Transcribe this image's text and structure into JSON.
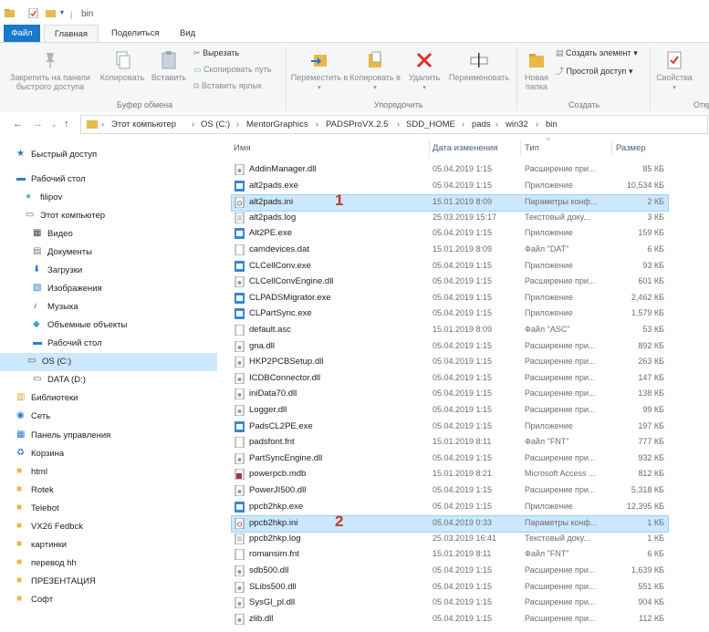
{
  "window": {
    "title": "bin"
  },
  "tabs": [
    {
      "label": "Файл"
    },
    {
      "label": "Главная"
    },
    {
      "label": "Поделиться"
    },
    {
      "label": "Вид"
    }
  ],
  "ribbon": {
    "pin_label": "Закрепить на панели быстрого доступа",
    "copy_label": "Копировать",
    "paste_label": "Вставить",
    "cut_label": "Вырезать",
    "copy_path_label": "Скопировать путь",
    "paste_shortcut_label": "Вставить ярлык",
    "clipboard_group": "Буфер обмена",
    "move_to_label": "Переместить в",
    "copy_to_label": "Копировать в",
    "delete_label": "Удалить",
    "rename_label": "Переименовать",
    "organize_group": "Упорядочить",
    "new_folder_label": "Новая папка",
    "new_item_label": "Создать элемент",
    "easy_access_label": "Простой доступ",
    "create_group": "Создать",
    "properties_label": "Свойства",
    "open_group": "Откр"
  },
  "address": {
    "crumbs": [
      "Этот компьютер",
      "OS (C:)",
      "MentorGraphics",
      "PADSProVX.2.5",
      "SDD_HOME",
      "pads",
      "win32",
      "bin"
    ]
  },
  "nav": {
    "items": [
      {
        "label": "Быстрый доступ",
        "icon": "star-icon"
      },
      {
        "label": "Рабочий стол",
        "icon": "desktop-icon"
      },
      {
        "label": "filipov",
        "icon": "user-icon"
      },
      {
        "label": "Этот компьютер",
        "icon": "computer-icon"
      },
      {
        "label": "Видео",
        "icon": "video-icon"
      },
      {
        "label": "Документы",
        "icon": "documents-icon"
      },
      {
        "label": "Загрузки",
        "icon": "download-icon"
      },
      {
        "label": "Изображения",
        "icon": "pictures-icon"
      },
      {
        "label": "Музыка",
        "icon": "music-icon"
      },
      {
        "label": "Объемные объекты",
        "icon": "3d-objects-icon"
      },
      {
        "label": "Рабочий стол",
        "icon": "desktop-icon"
      },
      {
        "label": "OS (C:)",
        "icon": "drive-icon"
      },
      {
        "label": "DATA (D:)",
        "icon": "drive-icon"
      },
      {
        "label": "Библиотеки",
        "icon": "libraries-icon"
      },
      {
        "label": "Сеть",
        "icon": "network-icon"
      },
      {
        "label": "Панель управления",
        "icon": "control-panel-icon"
      },
      {
        "label": "Корзина",
        "icon": "recycle-bin-icon"
      },
      {
        "label": "html",
        "icon": "folder-icon"
      },
      {
        "label": "Rotek",
        "icon": "folder-icon"
      },
      {
        "label": "Telebot",
        "icon": "folder-icon"
      },
      {
        "label": "VX26 Fedbck",
        "icon": "folder-icon"
      },
      {
        "label": "картинки",
        "icon": "folder-icon"
      },
      {
        "label": "перевод hh",
        "icon": "folder-icon"
      },
      {
        "label": "ПРЕЗЕНТАЦИЯ",
        "icon": "folder-icon"
      },
      {
        "label": "Софт",
        "icon": "folder-icon"
      }
    ],
    "selected_index": 11
  },
  "columns": {
    "name": "Имя",
    "date": "Дата изменения",
    "type": "Тип",
    "size": "Размер"
  },
  "files": [
    {
      "name": "AddinManager.dll",
      "date": "05.04.2019 1:15",
      "type": "Расширение при...",
      "size": "85 КБ",
      "icon": "dll"
    },
    {
      "name": "alt2pads.exe",
      "date": "05.04.2019 1:15",
      "type": "Приложение",
      "size": "10,534 КБ",
      "icon": "exe"
    },
    {
      "name": "alt2pads.ini",
      "date": "15.01.2019 8:09",
      "type": "Параметры конф...",
      "size": "2 КБ",
      "icon": "ini"
    },
    {
      "name": "alt2pads.log",
      "date": "25.03.2019 15:17",
      "type": "Текстовый доку...",
      "size": "3 КБ",
      "icon": "txt"
    },
    {
      "name": "Alt2PE.exe",
      "date": "05.04.2019 1:15",
      "type": "Приложение",
      "size": "159 КБ",
      "icon": "exe"
    },
    {
      "name": "camdevices.dat",
      "date": "15.01.2019 8:09",
      "type": "Файл \"DAT\"",
      "size": "6 КБ",
      "icon": "blank"
    },
    {
      "name": "CLCellConv.exe",
      "date": "05.04.2019 1:15",
      "type": "Приложение",
      "size": "93 КБ",
      "icon": "exe"
    },
    {
      "name": "CLCellConvEngine.dll",
      "date": "05.04.2019 1:15",
      "type": "Расширение при...",
      "size": "601 КБ",
      "icon": "dll"
    },
    {
      "name": "CLPADSMigrator.exe",
      "date": "05.04.2019 1:15",
      "type": "Приложение",
      "size": "2,462 КБ",
      "icon": "exe"
    },
    {
      "name": "CLPartSync.exe",
      "date": "05.04.2019 1:15",
      "type": "Приложение",
      "size": "1,579 КБ",
      "icon": "exe"
    },
    {
      "name": "default.asc",
      "date": "15.01.2019 8:09",
      "type": "Файл \"ASC\"",
      "size": "53 КБ",
      "icon": "blank"
    },
    {
      "name": "gna.dll",
      "date": "05.04.2019 1:15",
      "type": "Расширение при...",
      "size": "892 КБ",
      "icon": "dll"
    },
    {
      "name": "HKP2PCBSetup.dll",
      "date": "05.04.2019 1:15",
      "type": "Расширение при...",
      "size": "263 КБ",
      "icon": "dll"
    },
    {
      "name": "ICDBConnector.dll",
      "date": "05.04.2019 1:15",
      "type": "Расширение при...",
      "size": "147 КБ",
      "icon": "dll"
    },
    {
      "name": "iniData70.dll",
      "date": "05.04.2019 1:15",
      "type": "Расширение при...",
      "size": "138 КБ",
      "icon": "dll"
    },
    {
      "name": "Logger.dll",
      "date": "05.04.2019 1:15",
      "type": "Расширение при...",
      "size": "99 КБ",
      "icon": "dll"
    },
    {
      "name": "PadsCL2PE.exe",
      "date": "05.04.2019 1:15",
      "type": "Приложение",
      "size": "197 КБ",
      "icon": "exe"
    },
    {
      "name": "padsfont.fnt",
      "date": "15.01.2019 8:11",
      "type": "Файл \"FNT\"",
      "size": "777 КБ",
      "icon": "blank"
    },
    {
      "name": "PartSyncEngine.dll",
      "date": "05.04.2019 1:15",
      "type": "Расширение при...",
      "size": "932 КБ",
      "icon": "dll"
    },
    {
      "name": "powerpcb.mdb",
      "date": "15.01.2019 8:21",
      "type": "Microsoft Access ...",
      "size": "812 КБ",
      "icon": "mdb"
    },
    {
      "name": "PowerJI500.dll",
      "date": "05.04.2019 1:15",
      "type": "Расширение при...",
      "size": "5,318 КБ",
      "icon": "dll"
    },
    {
      "name": "ppcb2hkp.exe",
      "date": "05.04.2019 1:15",
      "type": "Приложение",
      "size": "12,395 КБ",
      "icon": "exe"
    },
    {
      "name": "ppcb2hkp.ini",
      "date": "05.04.2019 0:33",
      "type": "Параметры конф...",
      "size": "1 КБ",
      "icon": "ini"
    },
    {
      "name": "ppcb2hkp.log",
      "date": "25.03.2019 16:41",
      "type": "Текстовый доку...",
      "size": "1 КБ",
      "icon": "txt"
    },
    {
      "name": "romansim.fnt",
      "date": "15.01.2019 8:11",
      "type": "Файл \"FNT\"",
      "size": "6 КБ",
      "icon": "blank"
    },
    {
      "name": "sdb500.dll",
      "date": "05.04.2019 1:15",
      "type": "Расширение при...",
      "size": "1,639 КБ",
      "icon": "dll"
    },
    {
      "name": "SLibs500.dll",
      "date": "05.04.2019 1:15",
      "type": "Расширение при...",
      "size": "551 КБ",
      "icon": "dll"
    },
    {
      "name": "SysGl_pl.dll",
      "date": "05.04.2019 1:15",
      "type": "Расширение при...",
      "size": "904 КБ",
      "icon": "dll"
    },
    {
      "name": "zlib.dll",
      "date": "05.04.2019 1:15",
      "type": "Расширение при...",
      "size": "112 КБ",
      "icon": "dll"
    }
  ],
  "highlighted_rows": [
    2,
    22
  ],
  "annotations": [
    {
      "label": "1",
      "row": 2
    },
    {
      "label": "2",
      "row": 22
    }
  ],
  "colors": {
    "accent": "#1979ca",
    "selection": "#cce8ff",
    "annotation": "#c0392b"
  }
}
